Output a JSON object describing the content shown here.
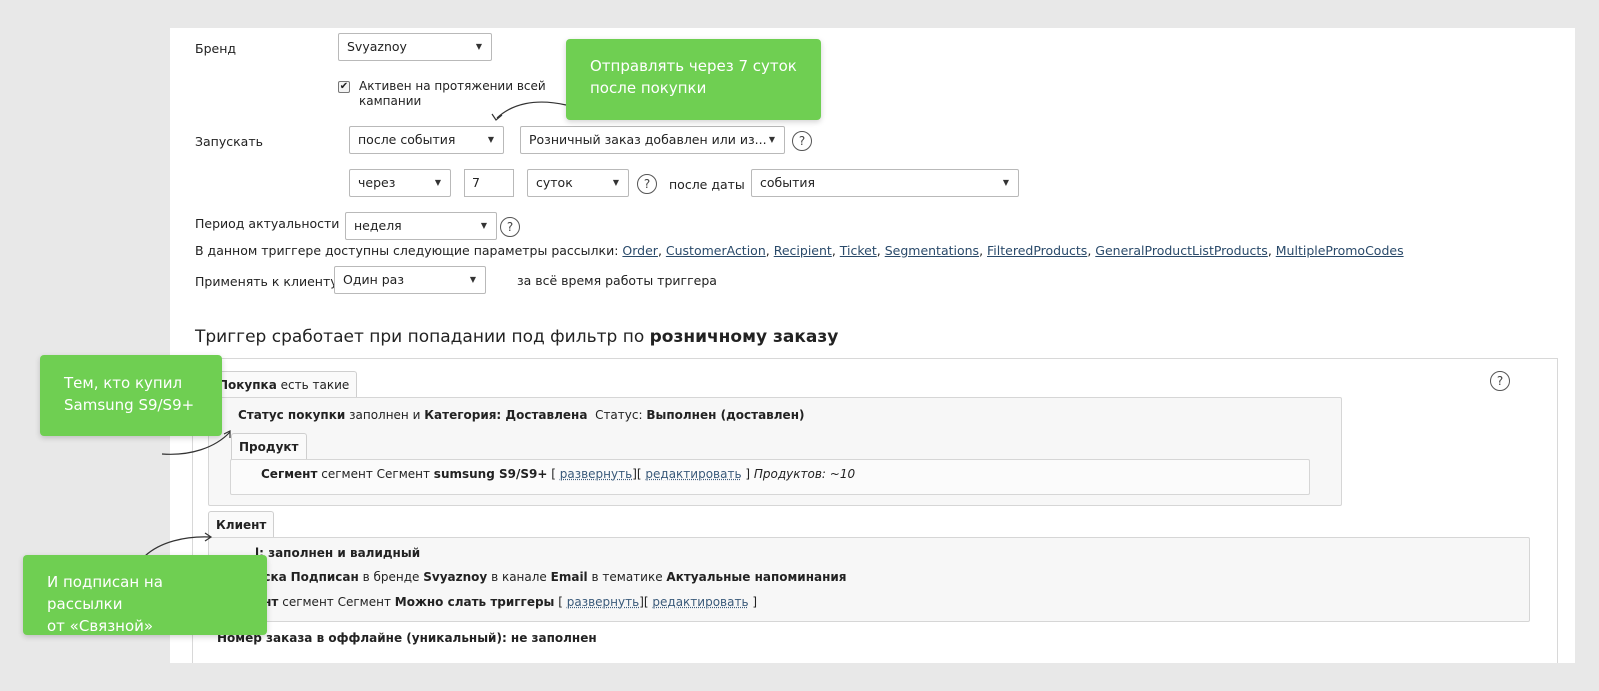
{
  "form": {
    "brand_label": "Бренд",
    "brand_value": "Svyaznoy",
    "active_all_label_1": "Активен на протяжении всей",
    "active_all_label_2": "кампании",
    "active_all_checked": true,
    "launch_label": "Запускать",
    "launch_mode": "после события",
    "launch_event": "Розничный заказ добавлен или из...",
    "delay_mode": "через",
    "delay_value": "7",
    "delay_unit": "суток",
    "after_date_label": "после даты",
    "after_date_value": "события",
    "period_label": "Период актуальности",
    "period_value": "неделя",
    "params_text": "В данном триггере доступны следующие параметры рассылки:",
    "params_links": [
      "Order",
      "CustomerAction",
      "Recipient",
      "Ticket",
      "Segmentations",
      "FilteredProducts",
      "GeneralProductListProducts",
      "MultiplePromoCodes"
    ],
    "apply_label": "Применять к клиенту",
    "apply_value": "Один раз",
    "apply_note": "за всё время работы триггера"
  },
  "filter": {
    "heading_prefix": "Триггер сработает при попадании под фильтр по",
    "heading_bold": "розничному заказу",
    "purchase_tab_bold": "Покупка",
    "purchase_tab_rest": "есть такие",
    "status_row": {
      "b1": "Статус покупки",
      "t1": "заполнен и",
      "b2": "Категория: Доставлена",
      "t2": "Статус:",
      "b3": "Выполнен (доставлен)"
    },
    "product_tab": "Продукт",
    "segment_row": {
      "b1": "Сегмент",
      "t1": "сегмент Сегмент",
      "b2": "sumsung S9/S9+",
      "open": "[",
      "expand": "развернуть",
      "mid": "][",
      "edit": "редактировать",
      "close": "]",
      "count": "Продуктов: ~10"
    },
    "client_tab": "Клиент",
    "client_row1": {
      "b1": "l: заполнен и валидный"
    },
    "client_row2": {
      "b1": "иска",
      "b2": "Подписан",
      "t1": "в бренде",
      "b3": "Svyaznoy",
      "t2": "в канале",
      "b4": "Email",
      "t3": "в тематике",
      "b5": "Актуальные напоминания"
    },
    "client_row3": {
      "b1": "ент",
      "t1": "сегмент Сегмент",
      "b2": "Можно слать триггеры",
      "open": "[",
      "expand": "развернуть",
      "mid": "][",
      "edit": "редактировать",
      "close": "]"
    },
    "offline_row": "Номер заказа в оффлайне (уникальный): не заполнен"
  },
  "callouts": {
    "top": [
      "Отправлять через 7 суток",
      "после покупки"
    ],
    "left": [
      "Тем, кто купил",
      "Samsung S9/S9+"
    ],
    "bottom": [
      "И подписан на рассылки",
      "от «Связной»"
    ]
  },
  "icons": {
    "help": "?",
    "dropdown": "▼",
    "checkbox": "✔"
  },
  "colors": {
    "callout_green": "#6fcf52",
    "link": "#2a4a6a",
    "panel_bg": "#ffffff",
    "page_bg": "#e8e8e8"
  }
}
